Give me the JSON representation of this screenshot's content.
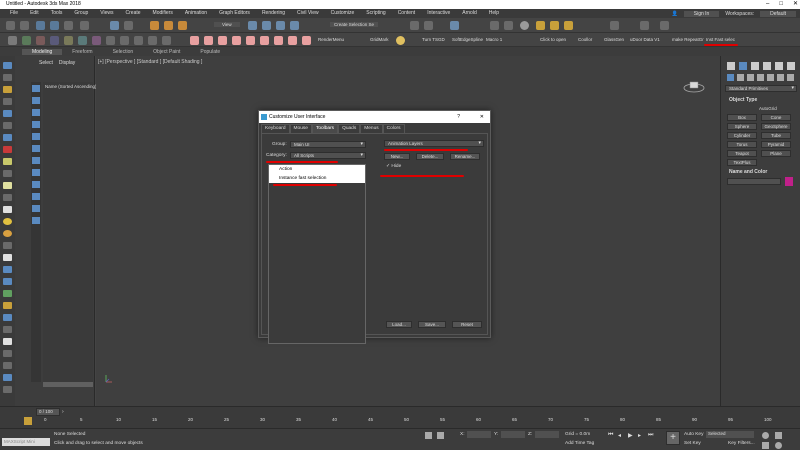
{
  "window": {
    "title": "Untitled - Autodesk 3ds Max 2018"
  },
  "menu": {
    "items": [
      "File",
      "Edit",
      "Tools",
      "Group",
      "Views",
      "Create",
      "Modifiers",
      "Animation",
      "Graph Editors",
      "Rendering",
      "Civil View",
      "Customize",
      "Scripting",
      "Content",
      "Interactive",
      "Arnold",
      "Help"
    ],
    "sign_in": "Sign In",
    "workspaces_label": "Workspaces:",
    "workspace_value": "Default"
  },
  "toolbar": {
    "view_select": "View",
    "selection_set": "Create Selection Se",
    "render_menu": "RenderMenu",
    "gridmark": "GridMark",
    "turn_tsgd": "Turn TSGD",
    "soft_edge": "SoftEdgeSpline",
    "macro": "Macro 1",
    "clicktoopen": "Click to open",
    "coollor": "Coollor",
    "glassgen": "GlassGen",
    "ldoor": "uDoor Data V1",
    "make_rep": "make RepeatGr",
    "instance_fast": "Inst Fast selec"
  },
  "ribbon": {
    "tabs": [
      "Modeling",
      "Freeform",
      "Selection",
      "Object Paint",
      "Populate"
    ]
  },
  "scene_explorer": {
    "tabs": [
      "Select",
      "Display"
    ],
    "column_header": "Name (Sorted Ascending)"
  },
  "viewport": {
    "label": "[+] [Perspective ] [Standard ] [Default Shading ]"
  },
  "command_panel": {
    "dropdown": "Standard Primitives",
    "rollout_object_type": "Object Type",
    "autogrid": "AutoGrid",
    "buttons": [
      "Box",
      "Cone",
      "Sphere",
      "GeoSphere",
      "Cylinder",
      "Tube",
      "Torus",
      "Pyramid",
      "Teapot",
      "Plane",
      "TextPlus"
    ],
    "rollout_name_color": "Name and Color"
  },
  "dialog": {
    "title": "Customize User Interface",
    "help_btn": "?",
    "close_btn": "✕",
    "tabs": [
      "Keyboard",
      "Mouse",
      "Toolbars",
      "Quads",
      "Menus",
      "Colors"
    ],
    "active_tab": "Toolbars",
    "group_label": "Group:",
    "group_value": "Main UI",
    "category_label": "Category:",
    "category_value": "All Scripts",
    "list_header": "Action",
    "list_items": [
      "Instance fast selection"
    ],
    "toolbar_select": "Animation Layers",
    "new_btn": "New...",
    "delete_btn": "Delete...",
    "rename_btn": "Rename...",
    "hide_label": "Hide",
    "load_btn": "Load...",
    "save_btn": "Save...",
    "reset_btn": "Reset"
  },
  "timeline": {
    "frame_range": "0 / 100",
    "ticks": [
      "0",
      "5",
      "10",
      "15",
      "20",
      "25",
      "30",
      "35",
      "40",
      "45",
      "50",
      "55",
      "60",
      "65",
      "70",
      "75",
      "80",
      "85",
      "90",
      "95",
      "100"
    ]
  },
  "status": {
    "maxscript": "MAXScript Mini",
    "selection": "None Selected",
    "prompt": "Click and drag to select and move objects",
    "x_label": "X:",
    "y_label": "Y:",
    "z_label": "Z:",
    "grid": "Grid = 0.0m",
    "add_time_tag": "Add Time Tag",
    "autokey": "Auto Key",
    "selected": "Selected",
    "set_key": "Set Key",
    "key_filters": "Key Filters..."
  },
  "colors": {
    "accent_red": "#e00000",
    "title_bg": "#ffffff"
  }
}
